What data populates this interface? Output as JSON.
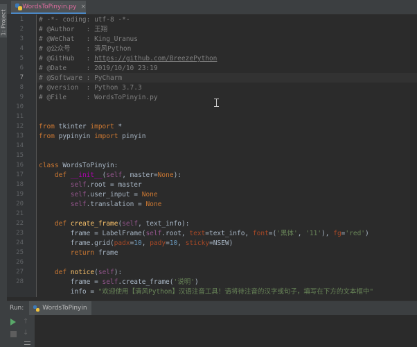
{
  "project_tab": {
    "label": "1: Project"
  },
  "editor_tab": {
    "label": "WordsToPinyin.py",
    "close": "×"
  },
  "colors": {
    "accent": "#4a88c7",
    "tab_text": "#e06c9f",
    "run_green": "#59a869"
  },
  "line_numbers": [
    "1",
    "2",
    "3",
    "4",
    "5",
    "6",
    "7",
    "8",
    "9",
    "10",
    "11",
    "12",
    "13",
    "14",
    "15",
    "16",
    "17",
    "18",
    "19",
    "20",
    "21",
    "22",
    "23",
    "24",
    "25",
    "26",
    "27",
    "28"
  ],
  "current_line": "7",
  "code_lines": [
    [
      {
        "t": "# -*- coding: utf-8 -*-",
        "c": "cmt"
      }
    ],
    [
      {
        "t": "# @Author   : 王翔",
        "c": "cmt"
      }
    ],
    [
      {
        "t": "# @WeChat   : King_Uranus",
        "c": "cmt"
      }
    ],
    [
      {
        "t": "# @公众号    : 清风Python",
        "c": "cmt"
      }
    ],
    [
      {
        "t": "# @GitHub   : ",
        "c": "cmt"
      },
      {
        "t": "https://github.com/BreezePython",
        "c": "cmt-link"
      }
    ],
    [
      {
        "t": "# @Date     : 2019/10/10 23:19",
        "c": "cmt"
      }
    ],
    [
      {
        "t": "# @Software : PyCharm",
        "c": "cmt"
      }
    ],
    [
      {
        "t": "# @version  : Python 3.7.3",
        "c": "cmt"
      }
    ],
    [
      {
        "t": "# @File     : WordsToPinyin.py",
        "c": "cmt"
      }
    ],
    [],
    [],
    [
      {
        "t": "from",
        "c": "kw"
      },
      {
        "t": " tkinter ",
        "c": "id"
      },
      {
        "t": "import",
        "c": "kw"
      },
      {
        "t": " *",
        "c": "id"
      }
    ],
    [
      {
        "t": "from",
        "c": "kw"
      },
      {
        "t": " pypinyin ",
        "c": "id"
      },
      {
        "t": "import",
        "c": "kw"
      },
      {
        "t": " pinyin",
        "c": "id"
      }
    ],
    [],
    [],
    [
      {
        "t": "class",
        "c": "kw"
      },
      {
        "t": " WordsToPinyin:",
        "c": "id"
      }
    ],
    [
      {
        "t": "    ",
        "c": "id"
      },
      {
        "t": "def",
        "c": "kw"
      },
      {
        "t": " ",
        "c": "id"
      },
      {
        "t": "__init__",
        "c": "magic"
      },
      {
        "t": "(",
        "c": "id"
      },
      {
        "t": "self",
        "c": "self"
      },
      {
        "t": ", master=",
        "c": "id"
      },
      {
        "t": "None",
        "c": "kw"
      },
      {
        "t": "):",
        "c": "id"
      }
    ],
    [
      {
        "t": "        ",
        "c": "id"
      },
      {
        "t": "self",
        "c": "self"
      },
      {
        "t": ".root = master",
        "c": "id"
      }
    ],
    [
      {
        "t": "        ",
        "c": "id"
      },
      {
        "t": "self",
        "c": "self"
      },
      {
        "t": ".user_input = ",
        "c": "id"
      },
      {
        "t": "None",
        "c": "kw"
      }
    ],
    [
      {
        "t": "        ",
        "c": "id"
      },
      {
        "t": "self",
        "c": "self"
      },
      {
        "t": ".translation = ",
        "c": "id"
      },
      {
        "t": "None",
        "c": "kw"
      }
    ],
    [],
    [
      {
        "t": "    ",
        "c": "id"
      },
      {
        "t": "def",
        "c": "kw"
      },
      {
        "t": " ",
        "c": "id"
      },
      {
        "t": "create_frame",
        "c": "fn"
      },
      {
        "t": "(",
        "c": "id"
      },
      {
        "t": "self",
        "c": "self"
      },
      {
        "t": ", text_info):",
        "c": "id"
      }
    ],
    [
      {
        "t": "        frame = LabelFrame(",
        "c": "id"
      },
      {
        "t": "self",
        "c": "self"
      },
      {
        "t": ".root, ",
        "c": "id"
      },
      {
        "t": "text",
        "c": "kwarg"
      },
      {
        "t": "=text_info, ",
        "c": "id"
      },
      {
        "t": "font",
        "c": "kwarg"
      },
      {
        "t": "=(",
        "c": "id"
      },
      {
        "t": "'黑体'",
        "c": "str"
      },
      {
        "t": ", ",
        "c": "id"
      },
      {
        "t": "'11'",
        "c": "str"
      },
      {
        "t": "), ",
        "c": "id"
      },
      {
        "t": "fg",
        "c": "kwarg"
      },
      {
        "t": "=",
        "c": "id"
      },
      {
        "t": "'red'",
        "c": "str"
      },
      {
        "t": ")",
        "c": "id"
      }
    ],
    [
      {
        "t": "        frame.grid(",
        "c": "id"
      },
      {
        "t": "padx",
        "c": "kwarg"
      },
      {
        "t": "=",
        "c": "id"
      },
      {
        "t": "10",
        "c": "num"
      },
      {
        "t": ", ",
        "c": "id"
      },
      {
        "t": "pady",
        "c": "kwarg"
      },
      {
        "t": "=",
        "c": "id"
      },
      {
        "t": "10",
        "c": "num"
      },
      {
        "t": ", ",
        "c": "id"
      },
      {
        "t": "sticky",
        "c": "kwarg"
      },
      {
        "t": "=NSEW)",
        "c": "id"
      }
    ],
    [
      {
        "t": "        ",
        "c": "id"
      },
      {
        "t": "return",
        "c": "kw"
      },
      {
        "t": " frame",
        "c": "id"
      }
    ],
    [],
    [
      {
        "t": "    ",
        "c": "id"
      },
      {
        "t": "def",
        "c": "kw"
      },
      {
        "t": " ",
        "c": "id"
      },
      {
        "t": "notice",
        "c": "fn"
      },
      {
        "t": "(",
        "c": "id"
      },
      {
        "t": "self",
        "c": "self"
      },
      {
        "t": "):",
        "c": "id"
      }
    ],
    [
      {
        "t": "        frame = ",
        "c": "id"
      },
      {
        "t": "self",
        "c": "self"
      },
      {
        "t": ".create_frame(",
        "c": "id"
      },
      {
        "t": "'说明'",
        "c": "str"
      },
      {
        "t": ")",
        "c": "id"
      }
    ],
    [
      {
        "t": "        info = ",
        "c": "id"
      },
      {
        "t": "\"欢迎使用【清风Python】汉语注音工具！请将待注音的汉字或句子，填写在下方的文本框中\"",
        "c": "str"
      }
    ]
  ],
  "run_panel": {
    "label": "Run:",
    "tab_label": "WordsToPinyin"
  },
  "run_toolbar": {
    "up": "↑",
    "down": "↓"
  }
}
